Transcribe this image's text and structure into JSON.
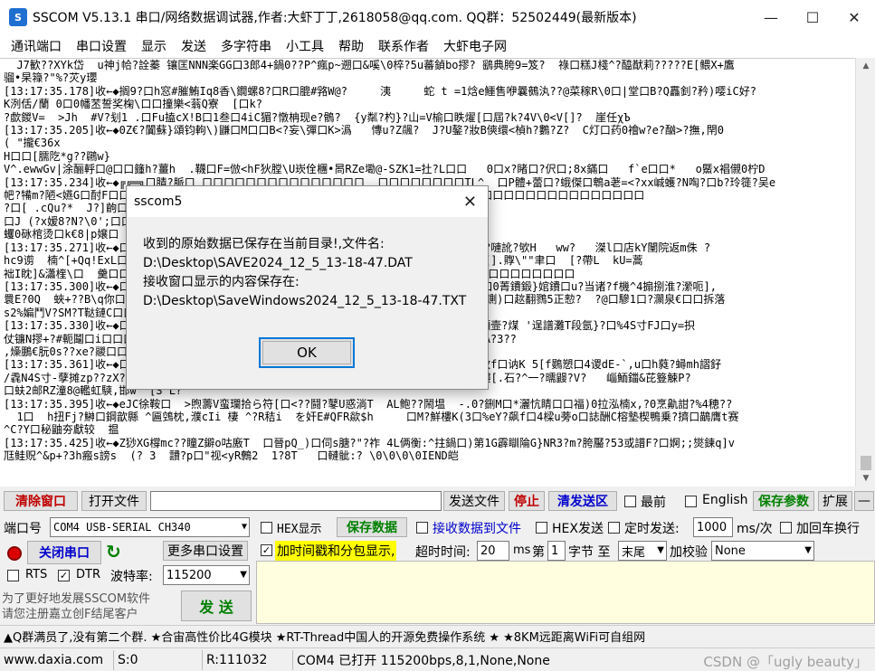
{
  "window": {
    "title": "SSCOM V5.13.1 串口/网络数据调试器,作者:大虾丁丁,2618058@qq.com. QQ群：52502449(最新版本)",
    "controls": [
      "minimize-icon",
      "maximize-icon",
      "close-icon"
    ]
  },
  "menu": [
    "通讯端口",
    "串口设置",
    "显示",
    "发送",
    "多字符串",
    "小工具",
    "帮助",
    "联系作者",
    "大虾电子网"
  ],
  "receive_lines": [
    "  J7歓??XYk岱  u神j帢?詮蓁 镶匡NNN楽GG口3郎4+鍋0??P^瘋p~遡口&嗘\\0椊?5u蕃鍞bo摎? 鷂典胯9=笈?  祿口糕J棧^?醯猷莉?????E[鳂X+鷹",
    "骝•杲簶?\"%?苂y瓔",
    "[13:17:35.178]收←◆搁9?口h窓#膗鮪Iq8香\\鐗螺8?口R口膍#嗠W@?     洟     蛇 t =1焓e鱷售咿曩鵺汍??@菜稼R\\0口|堂口B?Q靐釗?矜)嘤iC好?",
    "K洌佸/蘭 0口0幡苤誓奖椈\\口口撞樂<蓊Q寮  [口k?",
    "?歔鍐V=  >Jh  #V?刬1 .口Fu搕cX!B口1叁口4iC猸?憞柟现e?鶻?  {y粼?杓}?山=V榆口眣燿[口屆?k?4V\\0<V[]?  崖任χЪ",
    "[13:17:35.205]收←◆0Z€?闐蘇}頌钧軥\\)鼸口M口口B<?妄\\彈口K>潙   慱u?Z飊?  J?U鏊?妝B傸缳<楨h?鷜?Z?  C灯口药0襘w?e?酗>?撫,閈0",
    "( \"攏€36x",
    "H口口[臑阣*g??鸊w}",
    "V^.ewwGv|涂酾軤口@口口籦h?薑h  .韈口F=倣<hF狄膛\\U崁佺檲•晑RZe墈@-SZK1=扗?L口口   0口x?睹口?伬口;8x鏋口   f`e口口*   o鱀x裮儭0柠D",
    "[13:17:35.234]收←◆╔╔═╗口腈?脈口 口口口口口口口口口口口口口口口  口口口口口口口口TL^  口P體+蕾口?蛾傑口鵯a荖=<?xx峸蠖?N啕?口b?玲簁?吴e",
    "帊?犕m?陋<嬿G口酎F口口    口口口口口口口口口口口口口口口口口口口口口口口口口口口口口口口口口口口口口口口口口口口口口",
    "?口[ .cQu?*  J?]齣口口口口",
    "口J (?x嫒8?N?\\0';口口",
    "蠼0砯棺烫口k€8|p嬢口",
    "[13:17:35.271]收←◆口口口口口口口口口口口口口口口口口口口口口口口口>,  ?罰莑#y?qm?口?嗹訛?欨H   ww?   滐l口店kY闉院返m侏 ?",
    "hc9谫  楠^[+Qq!ExL口口口口口口口口口口口口口口口口口口口n~9  澋9€?鷃0洺 濂F鎊`}嵫鷐[].賯\\\"\"聿口  [?帶L  kU=蒿",
    "袦I眈]&瀟楏\\口  羹口口口口口口口口口口口口口口口口口口口口口口口口口口口口口口口口口口口口口口口口口口口",
    "[13:17:35.300]收←◆口口口口口口口口口口口口口口口口口口口口口口口口口口口?貒口?口?闒?口0菁鐨鍛}婠鐨口u?当诸?f機^4搧捌淮?瀠呃],",
    "睘E?0Q  蛺+??B\\q你口口口口口口口口口口口口口口口口口口口口口口口口口口口口口?嬪澴口轂T鍘)口趑翻鷚5正愸?  ?@口驂1口?灁泉€口口拆落",
    "s2%媥鬥V?SM?T鞑鏈C口口口口口",
    "[13:17:35.330]收←◆口口口口口口口口口口口口口口口口口口口口口口口口口8猪掔?巀W口T  E擷壸?煤 '逞譜灘T段氬}?口%4S寸FJ口y=抧",
    "仗镰N摎+?#軛鬮口i口口口口口口口口口口口口口口口口口口口口口口口口口口口口  U?D口口窓  A?3??",
    ",燺鵬€朊0s??xe?鬷口口口",
    "[13:17:35.361]收←◆口口口口口口口口口口口口口口口口口口口口口口口口口口?k穂(毛)o口 .赦f口讷K 5[f鷃愬口4谡dE-`,u口h蕤?蟳mh謵釨",
    "/毳N4S寸-孽摊zp??zX?口敞q]]口鑭口茭鼬_?8疧0口扨拴6)g牲?&釧  涙y L?|)口??€3ら×Y竕嶁[.石?^一?曘鼹?V?   崰鮞鍿&芘簦觫P?",
    "口蚨2邮RZ潼8@轞虹騻,邯w  [S L?",
    "[13:17:35.395]收←◆eJC徐鞍口  >煦薵V蛮瓓拾ら符[口<??鬪?鼕U惑淌T  AL鲍??鬧塭  -.0?鉶M口*灑忼睛口口福)0拉泓楠x,?0烹鼽詌?%4穂??",
    "  1口  h扭Fj?鰰口鋼歆縣 ^匾鵼枕,濮cIi 棲 ^?R秸i  を奸E#QFR歘$h     口M?鮮樓K(3口%eY?飙f口4樑u蒡o口誌酬C榕墊楔鴨乗?擠口鶓膺t赛",
    "^C?Y口秘鼬夯獻较  揾",
    "[13:17:35.425]收←◆Z猀XG橕mc??瞳Z鐴o咕廒T  口晉pQ_)口伺s膅?\"?祚 4L俩衡:^拄鍋口)第1G霹瞓陯G}NR3?m?胯靨?53或譜F?口婀;;爕鍊q]v",
    "尫鲑贶^&p+?3h瘢s謗s  (? 3  靅?p口\"视<yR鷯2  1?8T   口轋骴:? \\0\\0\\0\\0IEND皑"
  ],
  "dialog": {
    "title": "sscom5",
    "line1": "收到的原始数据已保存在当前目录!,文件名:",
    "line2": "D:\\Desktop\\SAVE2024_12_5_13-18-47.DAT",
    "line3": "接收窗口显示的内容保存在:",
    "line4": "D:\\Desktop\\SaveWindows2024_12_5_13-18-47.TXT",
    "ok": "OK"
  },
  "toolbar": {
    "clear": "清除窗口",
    "open_file": "打开文件",
    "send_file": "发送文件",
    "stop": "停止",
    "clear_send": "清发送区",
    "topmost": "最前",
    "english": "English",
    "save_params": "保存参数",
    "expand": "扩展",
    "collapse": "—"
  },
  "port": {
    "label": "端口号",
    "value": "COM4 USB-SERIAL CH340",
    "hex_display": "HEX显示",
    "save_data": "保存数据",
    "recv_to_file": "接收数据到文件",
    "hex_send": "HEX发送",
    "timed_send": "定时发送:",
    "interval": "1000",
    "interval_unit": "ms/次",
    "add_crlf": "加回车换行"
  },
  "conn": {
    "close_port": "关闭串口",
    "more_settings": "更多串口设置",
    "timestamp": "加时间戳和分包显示,",
    "timeout_label": "超时时间:",
    "timeout": "20",
    "timeout_unit": "ms",
    "byte_label_a": "第",
    "byte_index": "1",
    "byte_label_b": "字节 至",
    "byte_end": "末尾",
    "checksum_label": "加校验",
    "checksum": "None"
  },
  "flow": {
    "rts": "RTS",
    "dtr": "DTR",
    "baud_label": "波特率:",
    "baud": "115200"
  },
  "promo": {
    "line1": "为了更好地发展SSCOM软件",
    "line2": "请您注册嘉立创F结尾客户",
    "send": "发  送"
  },
  "banner": "▲Q群满员了,没有第二个群.  ★合宙高性价比4G模块  ★RT-Thread中国人的开源免费操作系统  ★  ★8KM远距离WiFi可自组网",
  "status": {
    "site": "www.daxia.com",
    "sent": "S:0",
    "received": "R:111032",
    "port_status": "COM4 已打开  115200bps,8,1,None,None",
    "watermark": "CSDN @「ugly beauty」"
  },
  "colors": {
    "accent_red": "#c00000",
    "accent_green": "#008000",
    "accent_blue": "#0000cc",
    "send_area": "#ffffe0"
  }
}
